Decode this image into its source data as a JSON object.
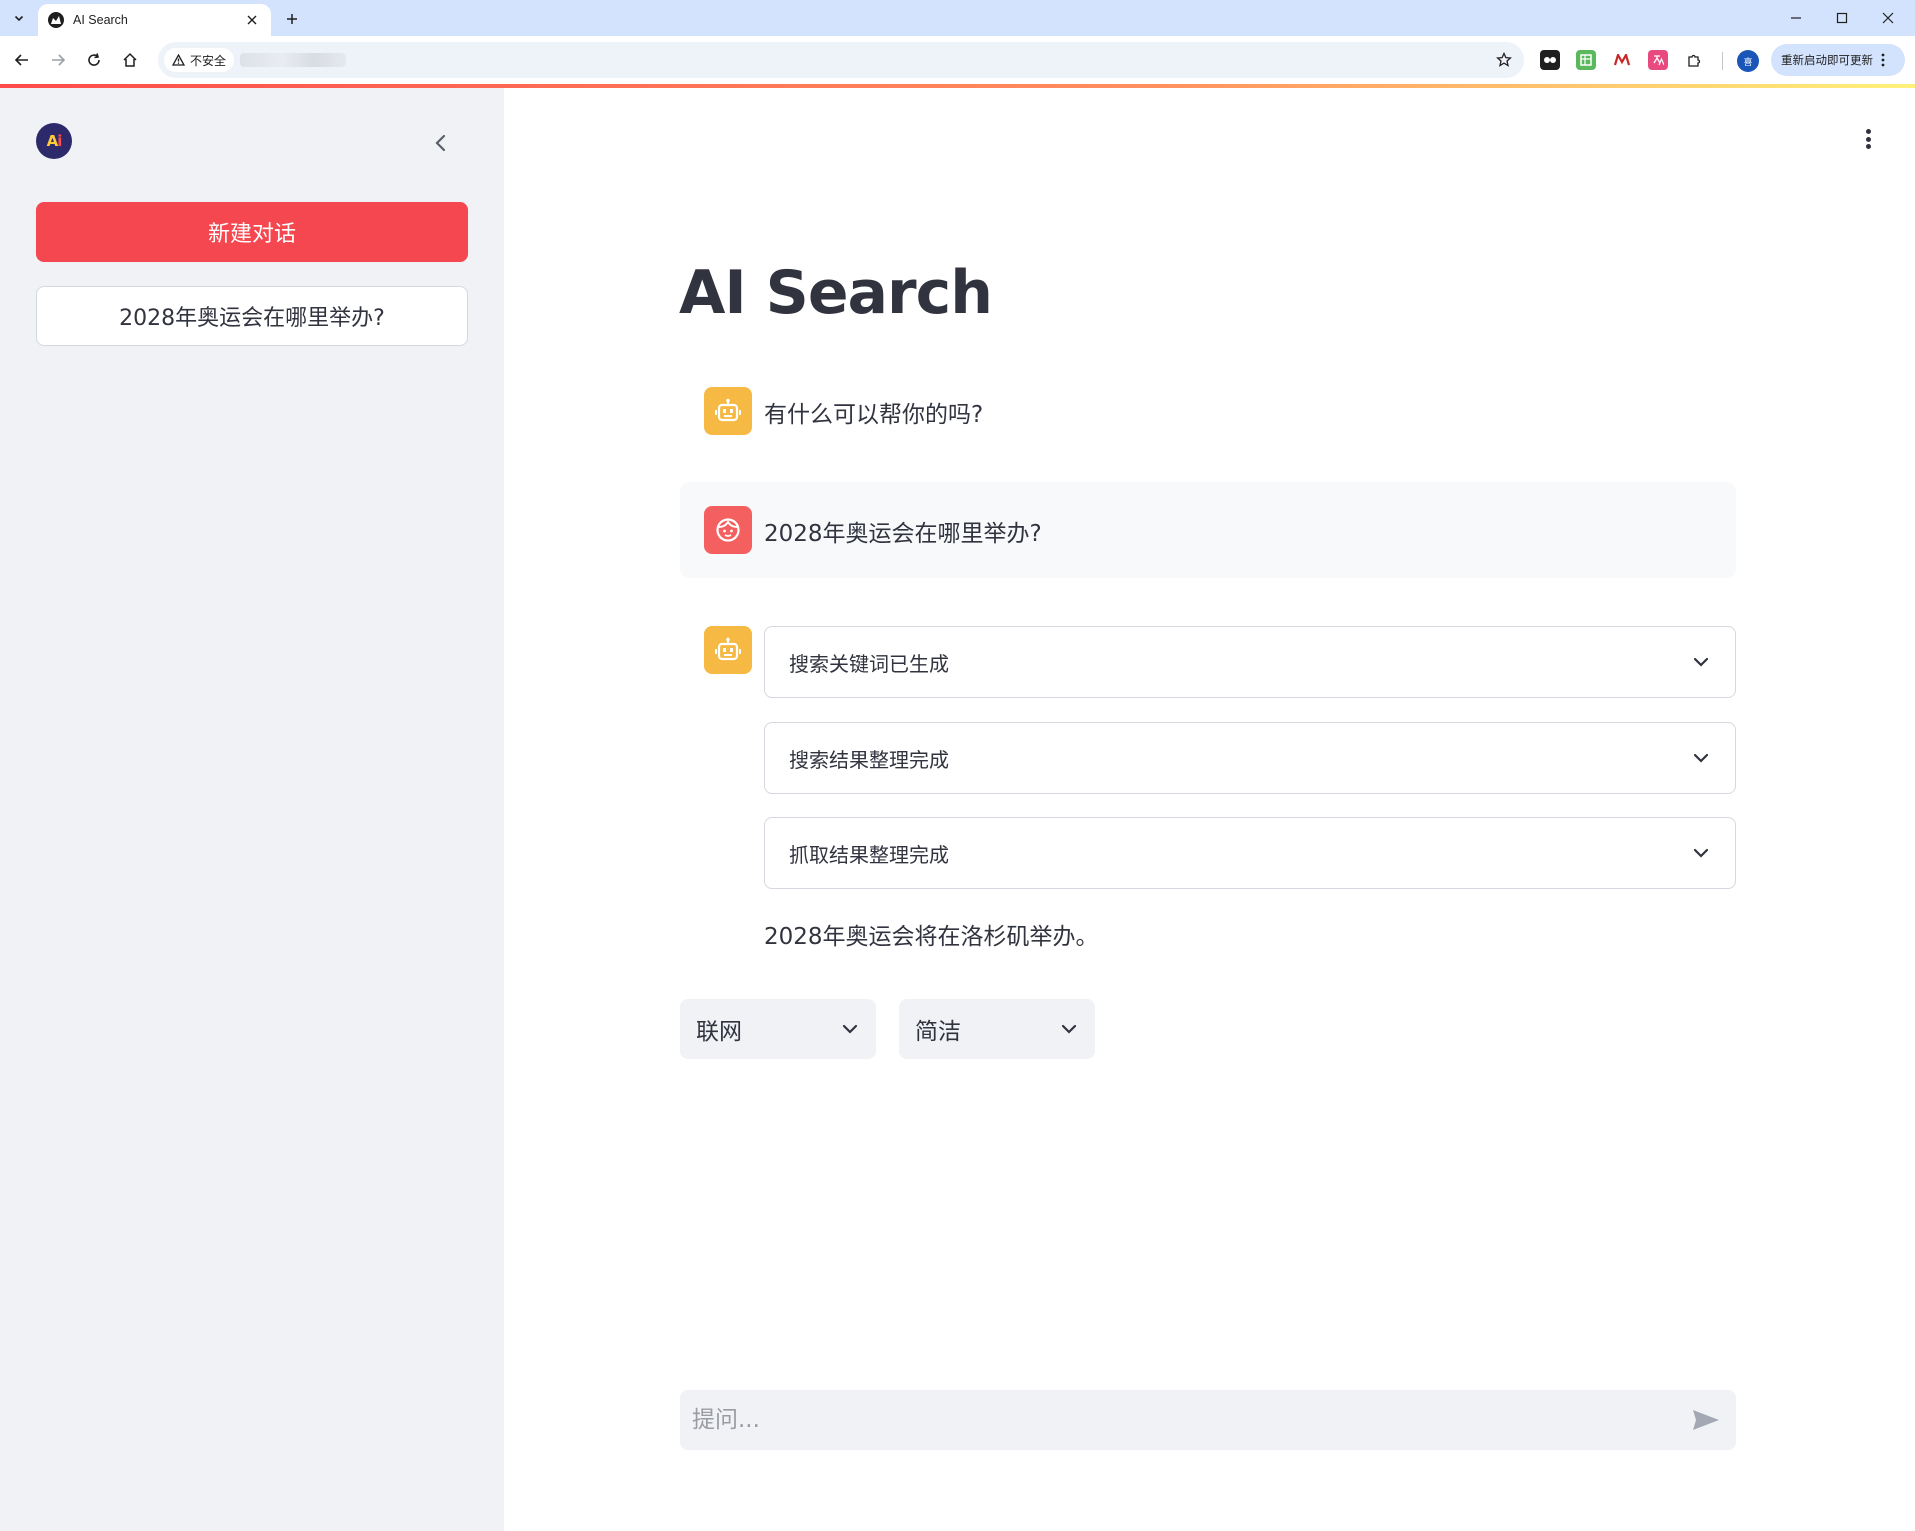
{
  "browser": {
    "tab_title": "AI Search",
    "security_label": "不安全",
    "update_label": "重新启动即可更新",
    "profile_initial": "喜",
    "extensions": [
      {
        "name": "ext-panda",
        "color": "#1f1f1f"
      },
      {
        "name": "ext-sheet",
        "color": "#4caf50"
      },
      {
        "name": "ext-m",
        "color": "#ffffff"
      },
      {
        "name": "ext-translate",
        "color": "#e84a7f"
      }
    ]
  },
  "sidebar": {
    "logo_text_a": "A",
    "logo_text_i": "i",
    "new_chat_label": "新建对话",
    "history": [
      {
        "label": "2028年奥运会在哪里举办?"
      }
    ]
  },
  "main": {
    "title": "AI Search",
    "messages": {
      "greeting": "有什么可以帮你的吗?",
      "user_question": "2028年奥运会在哪里举办?",
      "steps": [
        {
          "label": "搜索关键词已生成"
        },
        {
          "label": "搜索结果整理完成"
        },
        {
          "label": "抓取结果整理完成"
        }
      ],
      "answer": "2028年奥运会将在洛杉矶举办。"
    },
    "selects": [
      {
        "value": "联网"
      },
      {
        "value": "简洁"
      }
    ],
    "chat_input": {
      "placeholder": "提问..."
    }
  },
  "colors": {
    "primary": "#f4474f",
    "bot_avatar": "#f6b944",
    "user_avatar": "#f46060",
    "sidebar_bg": "#f0f2f6"
  }
}
